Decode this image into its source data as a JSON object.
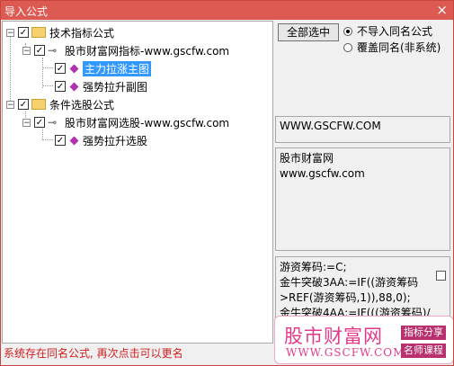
{
  "window": {
    "title": "导入公式",
    "close_glyph": "×"
  },
  "tree": {
    "group1": {
      "label": "技术指标公式",
      "toggle": "−",
      "checked": "✓"
    },
    "sub1": {
      "label": "股市财富网指标-www.gscfw.com",
      "toggle": "−",
      "checked": "✓"
    },
    "item1": {
      "label": "主力拉涨主图",
      "checked": "✓"
    },
    "item2": {
      "label": "强势拉升副图",
      "checked": "✓"
    },
    "group2": {
      "label": "条件选股公式",
      "toggle": "−",
      "checked": "✓"
    },
    "sub2": {
      "label": "股市财富网选股-www.gscfw.com",
      "toggle": "−",
      "checked": "✓"
    },
    "item3": {
      "label": "强势拉升选股",
      "checked": "✓"
    }
  },
  "buttons": {
    "select_all": "全部选中"
  },
  "options": {
    "no_import": "不导入同名公式",
    "overwrite": "覆盖同名(非系统)",
    "selected": "no_import"
  },
  "info": {
    "url_box": "WWW.GSCFW.COM",
    "desc_line1": "股市财富网",
    "desc_line2": "www.gscfw.com"
  },
  "code": {
    "line1": "游资筹码:=C;",
    "line2": "金牛突破3AA:=IF((游资筹码",
    "line3": ">REF(游资筹码,1)),88,0);",
    "line4": "金牛突破4AA:=IF(((游资筹码)/"
  },
  "status": "系统存在同名公式, 再次点击可以更名",
  "watermark": {
    "title": "股市财富网",
    "url": "WWW.GSCFW.COM",
    "tag1": "指标分享",
    "tag2": "名师课程"
  },
  "colors": {
    "titlebar": "#dc5a52",
    "status_text": "#d02020",
    "watermark": "#e23a8a",
    "selection": "#3399ff"
  }
}
